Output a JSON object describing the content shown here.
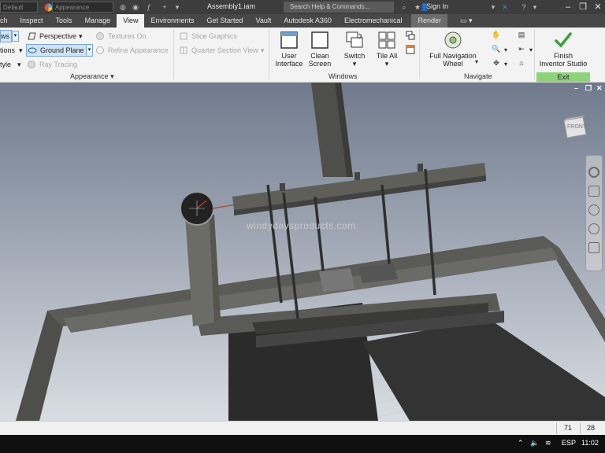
{
  "titlebar": {
    "material_value": "Default",
    "appearance_value": "Appearance",
    "title": "Assembly1.iam",
    "search_placeholder": "Search Help & Commands...",
    "sign_in": "Sign In"
  },
  "tabs": [
    {
      "label": "ch"
    },
    {
      "label": "Inspect"
    },
    {
      "label": "Tools"
    },
    {
      "label": "Manage"
    },
    {
      "label": "View"
    },
    {
      "label": "Environments"
    },
    {
      "label": "Get Started"
    },
    {
      "label": "Vault"
    },
    {
      "label": "Autodesk A360"
    },
    {
      "label": "Electromechanical"
    },
    {
      "label": "Render"
    }
  ],
  "ribbon": {
    "appearance": {
      "left_items": [
        "ws",
        "tions",
        "tyle"
      ],
      "perspective": "Perspective",
      "ground_plane": "Ground Plane",
      "ray_tracing": "Ray Tracing",
      "textures_on": "Textures On",
      "refine_appearance": "Refine Appearance",
      "label": "Appearance"
    },
    "slice": {
      "slice_graphics": "Slice Graphics",
      "quarter_section": "Quarter Section View"
    },
    "windows": {
      "user_interface": [
        "User",
        "Interface"
      ],
      "clean_screen": [
        "Clean",
        "Screen"
      ],
      "switch": "Switch",
      "tile_all": "Tile All",
      "label": "Windows"
    },
    "navigate": {
      "full_nav_wheel": [
        "Full Navigation",
        "Wheel"
      ],
      "label": "Navigate"
    },
    "exit": {
      "finish": [
        "Finish",
        "Inventor Studio"
      ],
      "label": "Exit"
    }
  },
  "viewport": {
    "watermark": "windydaysproducts.com",
    "viewcube_face": "FRONT"
  },
  "status": {
    "count_a": "71",
    "count_b": "28"
  },
  "taskbar": {
    "language": "ESP",
    "time": "11:02"
  },
  "colors": {
    "exit_green": "#8ed37a",
    "active_tab": "#f3f3f3",
    "titlebar": "#3d3d3d"
  }
}
